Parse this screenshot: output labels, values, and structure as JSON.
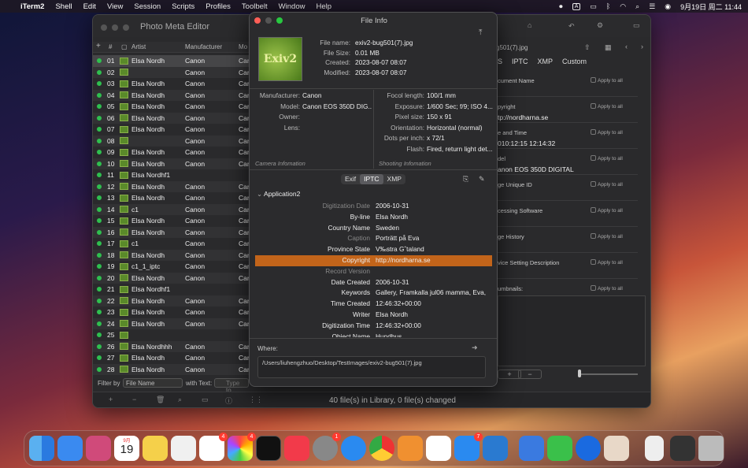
{
  "menubar": {
    "apple": "",
    "items": [
      "iTerm2",
      "Shell",
      "Edit",
      "View",
      "Session",
      "Scripts",
      "Profiles",
      "Toolbelt",
      "Window",
      "Help"
    ],
    "input_badge": "A",
    "datetime": "9月19日 周二 11:44"
  },
  "main": {
    "title": "Photo Meta Editor",
    "columns": {
      "plus": "+",
      "num": "#",
      "artist": "Artist",
      "manufacturer": "Manufacturer",
      "mo": "Mo"
    },
    "rows": [
      {
        "num": "01",
        "artist": "Elsa Nordh",
        "manu": "Canon",
        "mo": "Can"
      },
      {
        "num": "02",
        "artist": "",
        "manu": "Canon",
        "mo": "Car"
      },
      {
        "num": "03",
        "artist": "Elsa Nordh",
        "manu": "Canon",
        "mo": "Car"
      },
      {
        "num": "04",
        "artist": "Elsa Nordh",
        "manu": "Canon",
        "mo": "Car"
      },
      {
        "num": "05",
        "artist": "Elsa Nordh",
        "manu": "Canon",
        "mo": "Car"
      },
      {
        "num": "06",
        "artist": "Elsa Nordh",
        "manu": "Canon",
        "mo": "Car"
      },
      {
        "num": "07",
        "artist": "Elsa Nordh",
        "manu": "Canon",
        "mo": "Car"
      },
      {
        "num": "08",
        "artist": "",
        "manu": "Canon",
        "mo": "Car"
      },
      {
        "num": "09",
        "artist": "Elsa Nordh",
        "manu": "Canon",
        "mo": "Car"
      },
      {
        "num": "10",
        "artist": "Elsa Nordh",
        "manu": "Canon",
        "mo": "Car"
      },
      {
        "num": "11",
        "artist": "Elsa Nordhf1",
        "manu": "",
        "mo": ""
      },
      {
        "num": "12",
        "artist": "Elsa Nordh",
        "manu": "Canon",
        "mo": "Car"
      },
      {
        "num": "13",
        "artist": "Elsa Nordh",
        "manu": "Canon",
        "mo": "Car"
      },
      {
        "num": "14",
        "artist": "c1",
        "manu": "Canon",
        "mo": "Car"
      },
      {
        "num": "15",
        "artist": "Elsa Nordh",
        "manu": "Canon",
        "mo": "Car"
      },
      {
        "num": "16",
        "artist": "Elsa Nordh",
        "manu": "Canon",
        "mo": "Car"
      },
      {
        "num": "17",
        "artist": "c1",
        "manu": "Canon",
        "mo": "Car"
      },
      {
        "num": "18",
        "artist": "Elsa Nordh",
        "manu": "Canon",
        "mo": "Car"
      },
      {
        "num": "19",
        "artist": "c1_1_iptc",
        "manu": "Canon",
        "mo": "Car"
      },
      {
        "num": "20",
        "artist": "Elsa Nordh",
        "manu": "Canon",
        "mo": "Car"
      },
      {
        "num": "21",
        "artist": "Elsa Nordhf1",
        "manu": "",
        "mo": ""
      },
      {
        "num": "22",
        "artist": "Elsa Nordh",
        "manu": "Canon",
        "mo": "Car"
      },
      {
        "num": "23",
        "artist": "Elsa Nordh",
        "manu": "Canon",
        "mo": "Car"
      },
      {
        "num": "24",
        "artist": "Elsa Nordh",
        "manu": "Canon",
        "mo": "Car"
      },
      {
        "num": "25",
        "artist": "",
        "manu": "",
        "mo": ""
      },
      {
        "num": "26",
        "artist": "Elsa Nordhhh",
        "manu": "Canon",
        "mo": "Car"
      },
      {
        "num": "27",
        "artist": "Elsa Nordh",
        "manu": "Canon",
        "mo": "Car"
      },
      {
        "num": "28",
        "artist": "Elsa Nordh",
        "manu": "Canon",
        "mo": "Car"
      }
    ],
    "filter": {
      "label": "Filter by",
      "select": "File Name",
      "with_text": "with Text:",
      "placeholder": "Type to"
    },
    "status": "40 file(s) in Library, 0 file(s) changed",
    "right_tabs": [
      "S",
      "IPTC",
      "XMP",
      "Custom"
    ],
    "right_filename": "g501(7).jpg",
    "right_fields": [
      {
        "label": "cument Name",
        "value": ""
      },
      {
        "label": "pyright",
        "value": "tp://nordharna.se"
      },
      {
        "label": "e and Time",
        "value": "010:12:15 12:14:32"
      },
      {
        "label": "del",
        "value": "anon EOS 350D DIGITAL"
      },
      {
        "label": "ge Unique ID",
        "value": ""
      },
      {
        "label": "cessing Software",
        "value": ""
      },
      {
        "label": "ge History",
        "value": ""
      },
      {
        "label": "vice Setting Description",
        "value": ""
      },
      {
        "label": "umbnails:",
        "value": ""
      }
    ],
    "apply_label": "Apply to all"
  },
  "fileinfo": {
    "title": "File Info",
    "thumb_text": "Exiv2",
    "summary": [
      {
        "k": "File name:",
        "v": "exiv2-bug501(7).jpg"
      },
      {
        "k": "File Size:",
        "v": "0.01 MB"
      },
      {
        "k": "Created:",
        "v": "2023-08-07 08:07"
      },
      {
        "k": "Modified:",
        "v": "2023-08-07 08:07"
      }
    ],
    "camera": [
      {
        "k": "Manufacturer:",
        "v": "Canon"
      },
      {
        "k": "Model:",
        "v": "Canon EOS 350D DIG..."
      },
      {
        "k": "Owner:",
        "v": ""
      },
      {
        "k": "Lens:",
        "v": ""
      }
    ],
    "camera_caption": "Camera Infomation",
    "shooting": [
      {
        "k": "Focol length:",
        "v": "100/1 mm"
      },
      {
        "k": "Exposure:",
        "v": "1/600 Sec; f/9; ISO 4..."
      },
      {
        "k": "Pixel size:",
        "v": "150 x 91"
      },
      {
        "k": "Orientation:",
        "v": "Horizontal (normal)"
      },
      {
        "k": "Dots per inch:",
        "v": "x 72/1"
      },
      {
        "k": "Flash:",
        "v": "Fired, return light det..."
      }
    ],
    "shooting_caption": "Shooting Infomation",
    "tabs": [
      "Exif",
      "IPTC",
      "XMP"
    ],
    "section": "Application2",
    "iptc": [
      {
        "k": "Digitization Date",
        "v": "2006-10-31",
        "dim": true
      },
      {
        "k": "By-line",
        "v": "Elsa Nordh",
        "dim": false
      },
      {
        "k": "Country Name",
        "v": "Sweden",
        "dim": false
      },
      {
        "k": "Caption",
        "v": "Porträtt på Eva",
        "dim": true
      },
      {
        "k": "Province State",
        "v": "V‰stra Gˆtaland",
        "dim": false
      },
      {
        "k": "Copyright",
        "v": "http://nordharna.se",
        "dim": false
      },
      {
        "k": "Record Version",
        "v": "",
        "dim": true
      },
      {
        "k": "Date Created",
        "v": "2006-10-31",
        "dim": false
      },
      {
        "k": "Keywords",
        "v": "Gallery, Framkalla jul06 mamma, Eva,",
        "dim": false
      },
      {
        "k": "Time Created",
        "v": "12:46:32+00:00",
        "dim": false
      },
      {
        "k": "Writer",
        "v": "Elsa Nordh",
        "dim": false
      },
      {
        "k": "Digitization Time",
        "v": "12:46:32+00:00",
        "dim": false
      },
      {
        "k": "Object Name",
        "v": "Hundbus",
        "dim": false
      }
    ],
    "where_label": "Where:",
    "where_path": "/Users/liuhengzhuo/Desktop/TestImages/exiv2-bug501(7).jpg"
  },
  "dock": {
    "calendar_month": "9月",
    "calendar_day": "19",
    "badges": {
      "reminders": "4",
      "photos": "4",
      "settings": "1",
      "appstore": "7"
    }
  }
}
